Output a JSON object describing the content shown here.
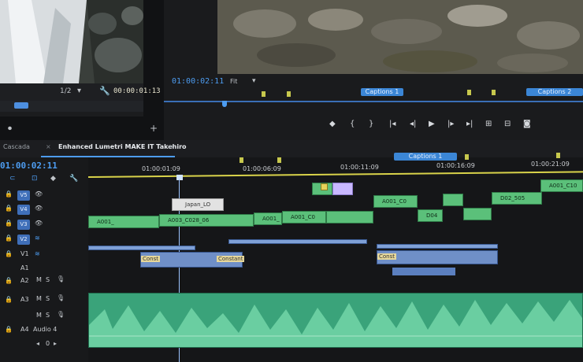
{
  "source": {
    "page": "1/2",
    "timecode": "00:00:01:13"
  },
  "program": {
    "timecode": "01:00:02:11",
    "fit": "Fit",
    "captions": [
      "Captions 1",
      "Captions 2"
    ]
  },
  "timeline": {
    "tabs": [
      "Cascada",
      "Enhanced Lumetri MAKE IT Takehiro"
    ],
    "tab_menu": "≡",
    "timecode": "01:00:02:11",
    "ruler": [
      "01:00:01:09",
      "01:00:06:09",
      "01:00:11:09",
      "01:00:16:09",
      "01:00:21:09"
    ],
    "caption_track": "Captions 1",
    "tracks": {
      "video": [
        "V5",
        "V4",
        "V3",
        "V2",
        "V1"
      ],
      "audio": [
        "A1",
        "A2",
        "A3",
        "A4"
      ],
      "a4_name": "Audio 4",
      "ms": [
        "M",
        "S"
      ],
      "vol": "0"
    },
    "clips": {
      "v3": [
        "A001_",
        "A003_C028_06",
        "A001_",
        "A001_C0",
        "A001_C0",
        "D04",
        "D02_505",
        "A001_C10"
      ],
      "v4_label": "Japan_LO",
      "a2": [
        "Const",
        "Constant"
      ],
      "a3": "Const"
    }
  }
}
